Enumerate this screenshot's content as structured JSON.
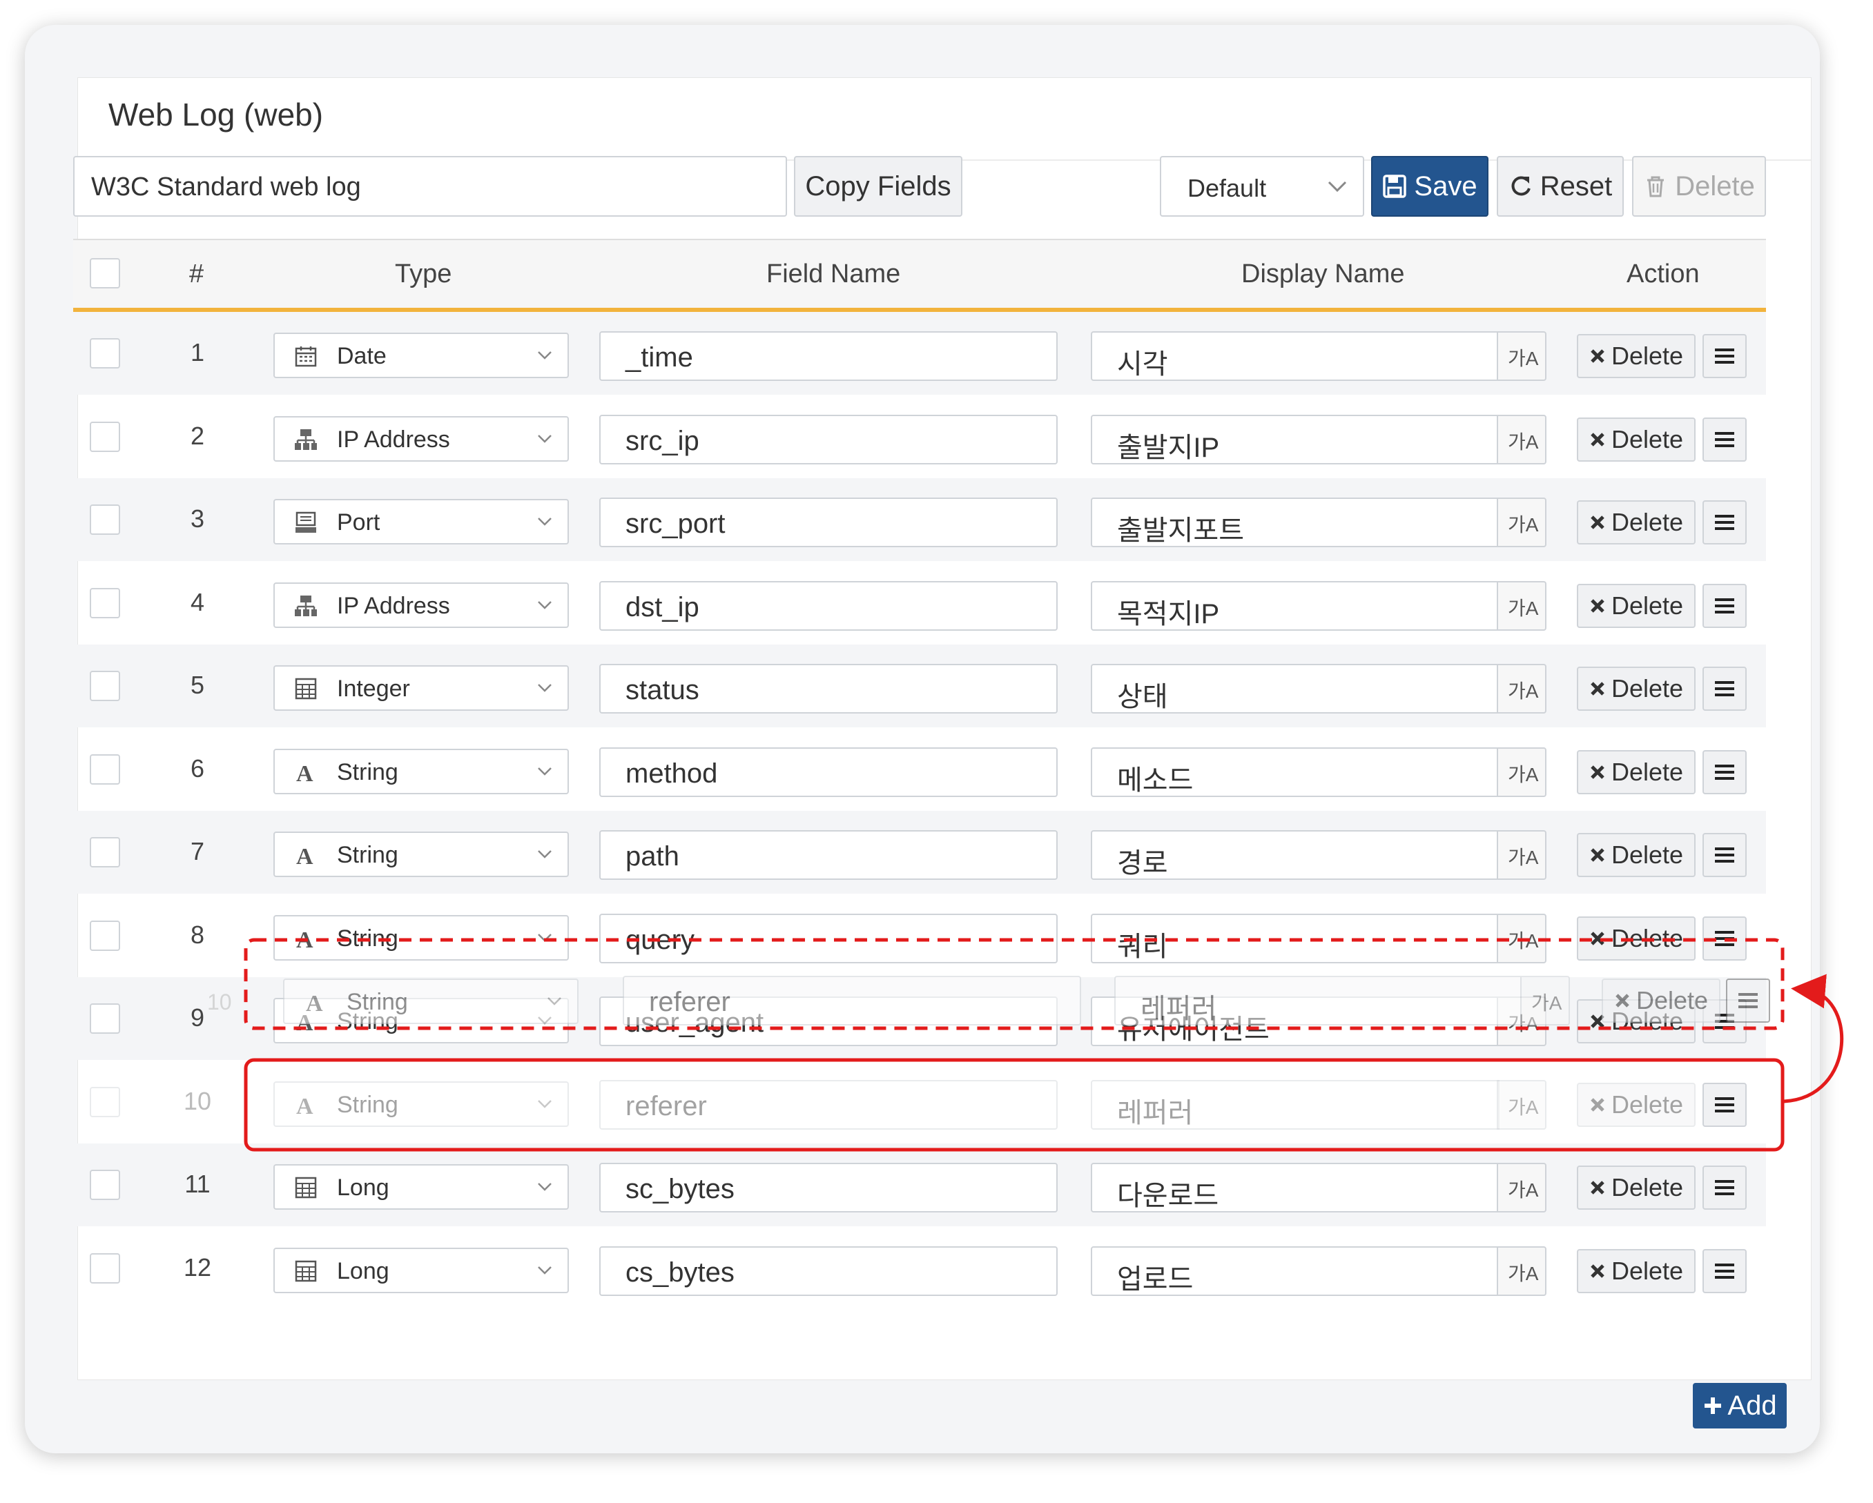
{
  "panel": {
    "title": "Web Log (web)"
  },
  "toolbar": {
    "description_value": "W3C Standard web log",
    "copy_fields_label": "Copy Fields",
    "profile_select_value": "Default",
    "save_label": "Save",
    "reset_label": "Reset",
    "delete_label": "Delete"
  },
  "table": {
    "headers": {
      "num": "#",
      "type": "Type",
      "field_name": "Field Name",
      "display_name": "Display Name",
      "action": "Action"
    },
    "rows": [
      {
        "num": "1",
        "type": "Date",
        "type_icon": "calendar-icon",
        "field": "_time",
        "display": "시각",
        "state": "normal"
      },
      {
        "num": "2",
        "type": "IP Address",
        "type_icon": "network-icon",
        "field": "src_ip",
        "display": "출발지IP",
        "state": "normal"
      },
      {
        "num": "3",
        "type": "Port",
        "type_icon": "port-icon",
        "field": "src_port",
        "display": "출발지포트",
        "state": "normal"
      },
      {
        "num": "4",
        "type": "IP Address",
        "type_icon": "network-icon",
        "field": "dst_ip",
        "display": "목적지IP",
        "state": "normal"
      },
      {
        "num": "5",
        "type": "Integer",
        "type_icon": "number-icon",
        "field": "status",
        "display": "상태",
        "state": "normal"
      },
      {
        "num": "6",
        "type": "String",
        "type_icon": "string-icon",
        "field": "method",
        "display": "메소드",
        "state": "normal"
      },
      {
        "num": "7",
        "type": "String",
        "type_icon": "string-icon",
        "field": "path",
        "display": "경로",
        "state": "normal"
      },
      {
        "num": "8",
        "type": "String",
        "type_icon": "string-icon",
        "field": "query",
        "display": "쿼리",
        "state": "normal"
      },
      {
        "num": "9",
        "type": "String",
        "type_icon": "string-icon",
        "field": "user_agent",
        "display": "유저에이전트",
        "state": "normal"
      },
      {
        "num": "10",
        "type": "String",
        "type_icon": "string-icon",
        "field": "referer",
        "display": "레퍼러",
        "state": "dragging"
      },
      {
        "num": "11",
        "type": "Long",
        "type_icon": "number-icon",
        "field": "sc_bytes",
        "display": "다운로드",
        "state": "normal"
      },
      {
        "num": "12",
        "type": "Long",
        "type_icon": "number-icon",
        "field": "cs_bytes",
        "display": "업로드",
        "state": "normal"
      }
    ],
    "row_delete_label": "Delete",
    "translate_glyph": "가A"
  },
  "drag_ghost": {
    "num": "10",
    "type": "String",
    "field": "referer",
    "display": "레퍼러",
    "delete_label": "Delete"
  },
  "footer": {
    "add_label": "Add"
  },
  "colors": {
    "primary": "#23558f",
    "header_accent": "#f2b33d",
    "annotation_red": "#e31b1b"
  }
}
